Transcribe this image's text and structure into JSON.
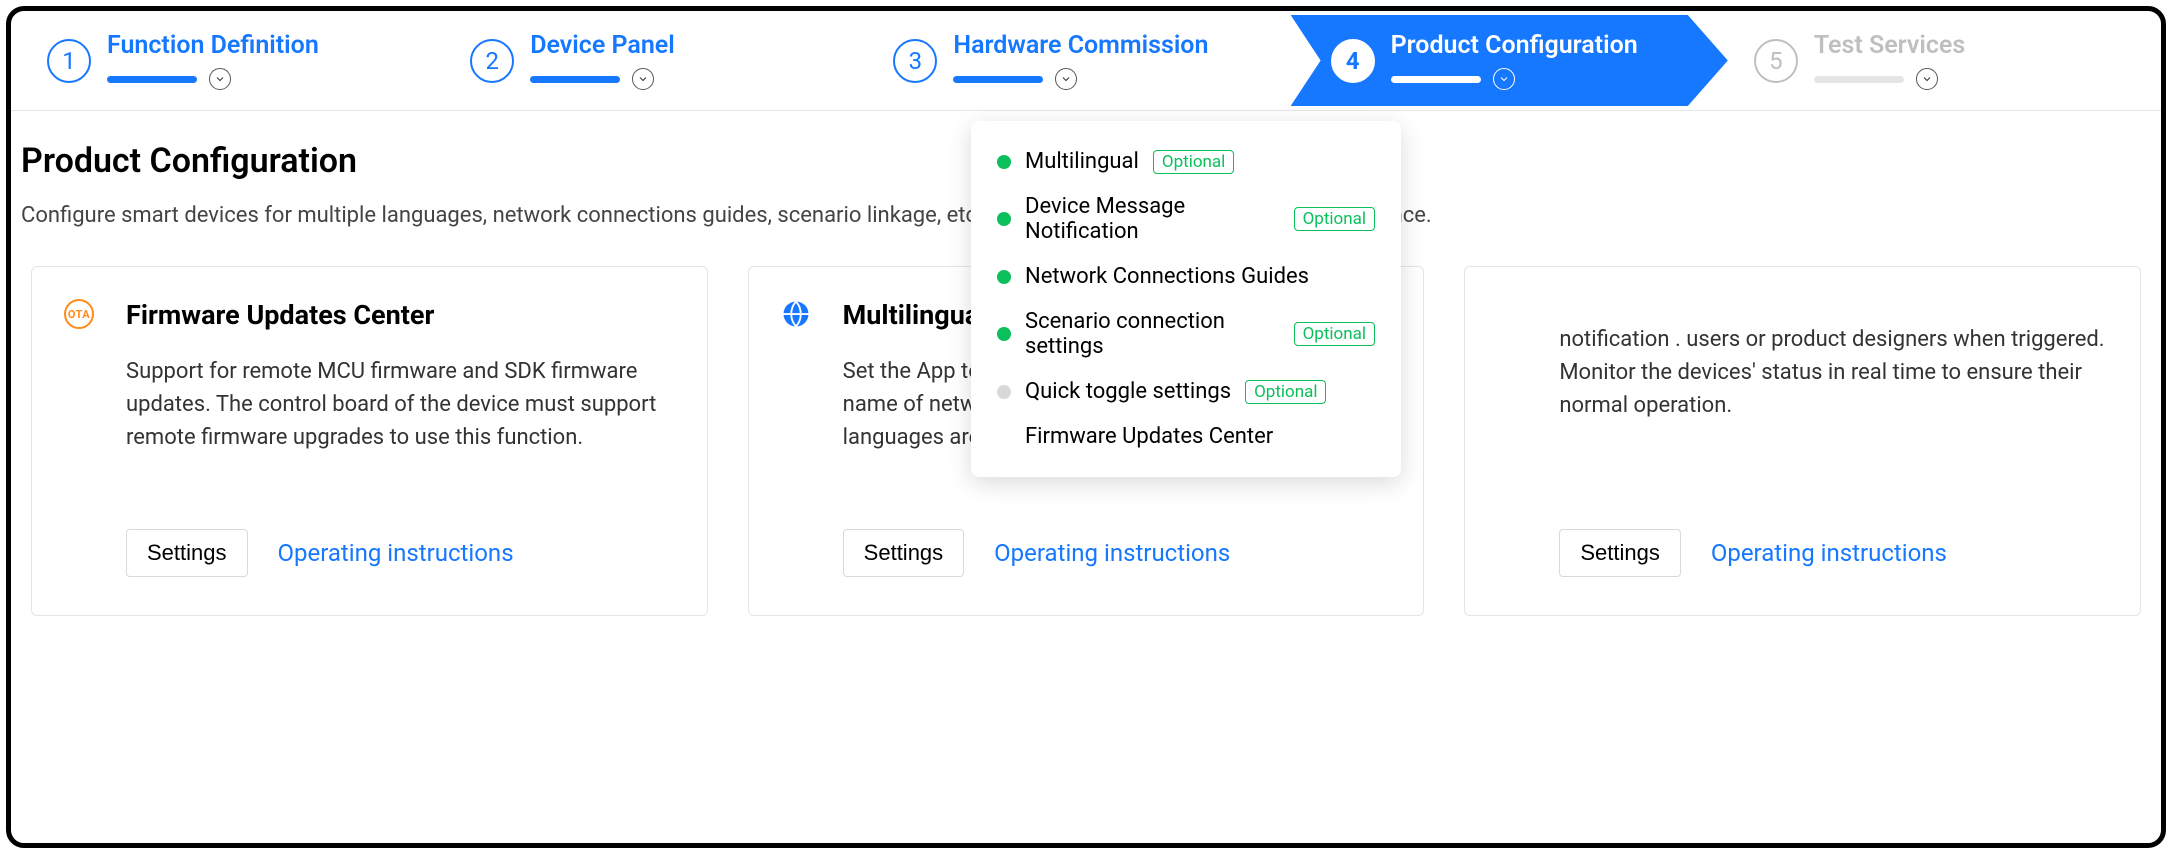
{
  "stepper": {
    "steps": [
      {
        "num": "1",
        "label": "Function Definition"
      },
      {
        "num": "2",
        "label": "Device Panel"
      },
      {
        "num": "3",
        "label": "Hardware Commission"
      },
      {
        "num": "4",
        "label": "Product Configuration"
      },
      {
        "num": "5",
        "label": "Test Services"
      }
    ]
  },
  "page": {
    "title": "Product Configuration",
    "desc": "Configure smart devices for multiple languages, network connections guides, scenario linkage, etc. to optimize the smart device user experience."
  },
  "dropdown": {
    "items": [
      {
        "label": "Multilingual",
        "status": "green",
        "badge": "Optional"
      },
      {
        "label": "Device Message Notification",
        "status": "green",
        "badge": "Optional"
      },
      {
        "label": "Network Connections Guides",
        "status": "green",
        "badge": null
      },
      {
        "label": "Scenario connection settings",
        "status": "green",
        "badge": "Optional"
      },
      {
        "label": "Quick toggle settings",
        "status": "grey",
        "badge": "Optional"
      },
      {
        "label": "Firmware Updates Center",
        "status": "none",
        "badge": null
      }
    ]
  },
  "cards": [
    {
      "icon": "ota",
      "icon_text": "OTA",
      "title": "Firmware Updates Center",
      "desc": "Support for remote MCU firmware and SDK firmware updates. The control board of the device must support remote firmware upgrades to use this function.",
      "settings": "Settings",
      "link": "Operating instructions"
    },
    {
      "icon": "globe",
      "title": "Multilingual",
      "desc": "Set the App texts in multiple languages, incl. category name of network configuration and push message. All languages are supported.",
      "settings": "Settings",
      "link": "Operating instructions"
    },
    {
      "icon": "none",
      "title": "",
      "desc": "notification . users or product designers when triggered. Monitor the devices' status in real time to ensure their normal operation.",
      "settings": "Settings",
      "link": "Operating instructions"
    }
  ]
}
